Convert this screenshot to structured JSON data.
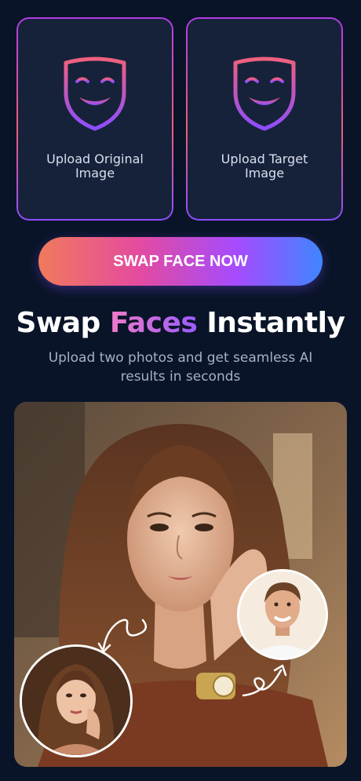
{
  "upload": {
    "original_label": "Upload Original Image",
    "target_label": "Upload Target Image"
  },
  "actions": {
    "swap_label": "SWAP FACE NOW"
  },
  "hero": {
    "title_start": "Swap",
    "title_accent": "Faces",
    "title_end": "Instantly",
    "subtitle": "Upload two photos and get seamless AI results in seconds"
  },
  "icons": {
    "upload_icon": "theater-mask-icon",
    "arrows": "curved-arrow-icon"
  },
  "colors": {
    "background": "#0a1428",
    "card": "#16223a",
    "accent_pink": "#e44b9e",
    "accent_purple": "#a54bff",
    "accent_blue": "#3f86ff"
  }
}
